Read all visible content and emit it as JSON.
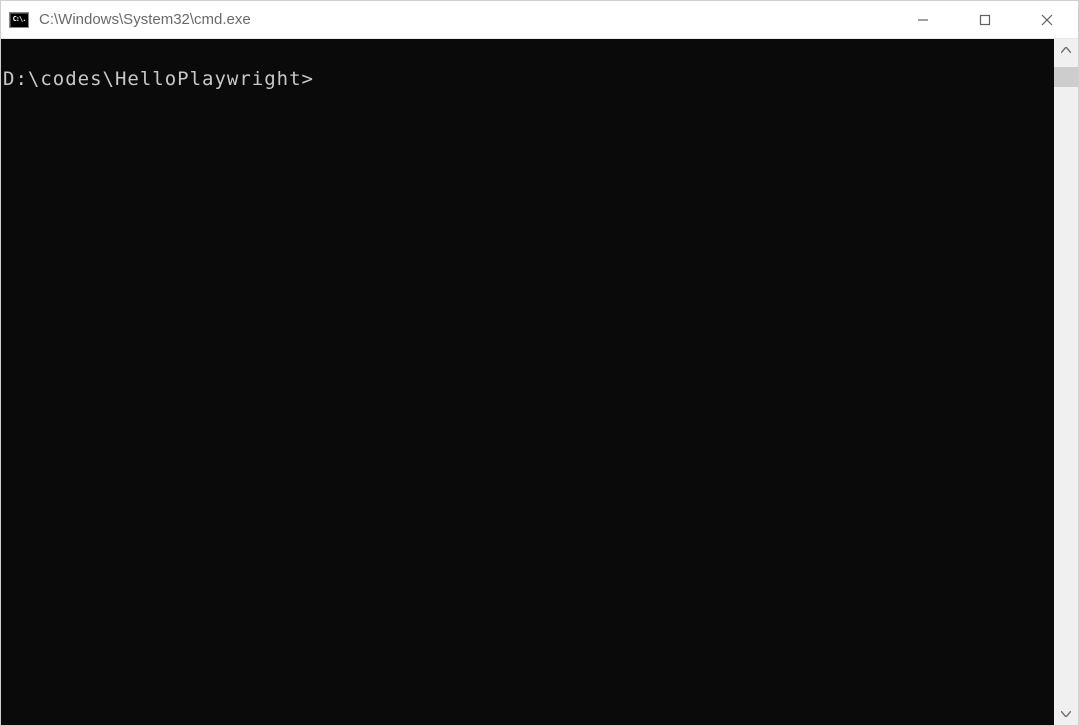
{
  "titlebar": {
    "icon_glyph": "C:\\.",
    "title": "C:\\Windows\\System32\\cmd.exe"
  },
  "terminal": {
    "prompt": "D:\\codes\\HelloPlaywright>",
    "background_color": "#0a0a0a",
    "text_color": "#c8c8c8"
  },
  "window_controls": {
    "minimize_label": "Minimize",
    "maximize_label": "Maximize",
    "close_label": "Close"
  }
}
